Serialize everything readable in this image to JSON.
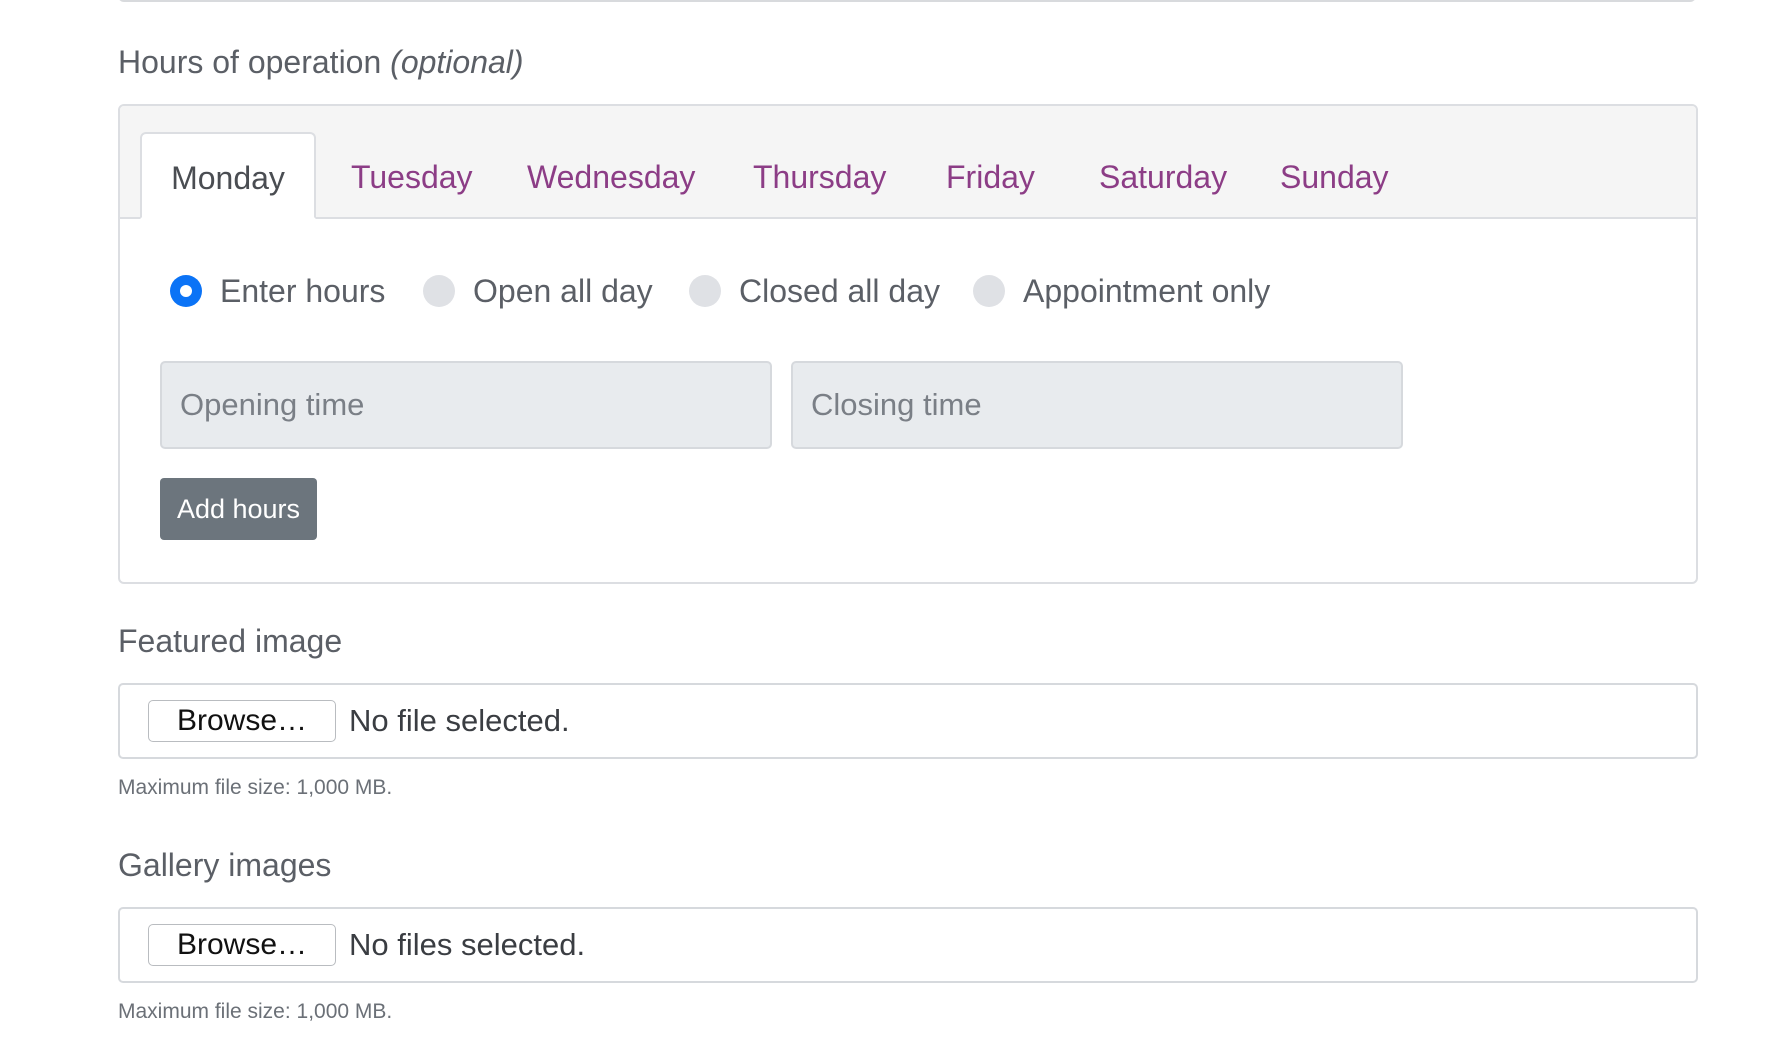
{
  "hours": {
    "label": "Hours of operation",
    "optional": "(optional)",
    "tabs": [
      {
        "label": "Monday",
        "active": true
      },
      {
        "label": "Tuesday",
        "active": false
      },
      {
        "label": "Wednesday",
        "active": false
      },
      {
        "label": "Thursday",
        "active": false
      },
      {
        "label": "Friday",
        "active": false
      },
      {
        "label": "Saturday",
        "active": false
      },
      {
        "label": "Sunday",
        "active": false
      }
    ],
    "radios": [
      {
        "label": "Enter hours",
        "checked": true
      },
      {
        "label": "Open all day",
        "checked": false
      },
      {
        "label": "Closed all day",
        "checked": false
      },
      {
        "label": "Appointment only",
        "checked": false
      }
    ],
    "opening_placeholder": "Opening time",
    "closing_placeholder": "Closing time",
    "add_hours_label": "Add hours"
  },
  "featured_image": {
    "label": "Featured image",
    "browse_label": "Browse…",
    "status": "No file selected.",
    "help": "Maximum file size: 1,000 MB."
  },
  "gallery_images": {
    "label": "Gallery images",
    "browse_label": "Browse…",
    "status": "No files selected.",
    "help": "Maximum file size: 1,000 MB."
  },
  "colors": {
    "tab_link": "#8c3d86",
    "radio_checked": "#0b73f6",
    "button_secondary": "#6c757d"
  }
}
